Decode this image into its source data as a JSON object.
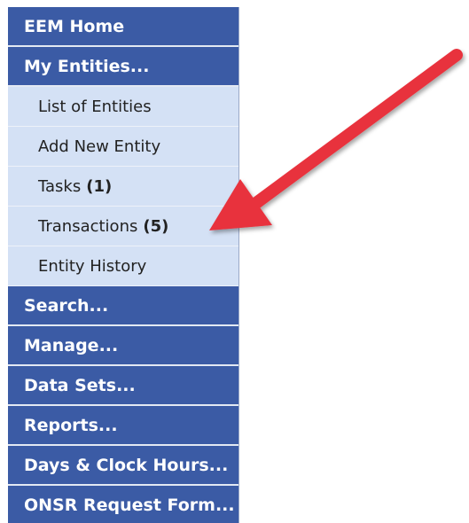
{
  "nav": {
    "home": "EEM Home",
    "my_entities": "My Entities...",
    "sub_items": {
      "list_entities": "List of Entities",
      "add_entity": "Add New Entity",
      "tasks": "Tasks",
      "tasks_count": "(1)",
      "transactions": "Transactions",
      "transactions_count": "(5)",
      "entity_history": "Entity History"
    },
    "search": "Search...",
    "manage": "Manage...",
    "data_sets": "Data Sets...",
    "reports": "Reports...",
    "days_clock_hours": "Days & Clock Hours...",
    "onsr_request": "ONSR Request Form..."
  },
  "colors": {
    "main_bg": "#3b5ba5",
    "sub_bg": "#d4e1f5",
    "arrow": "#e8333d"
  },
  "annotation": {
    "arrow_icon": "red-pointer-arrow-icon",
    "points_to": "Transactions"
  }
}
